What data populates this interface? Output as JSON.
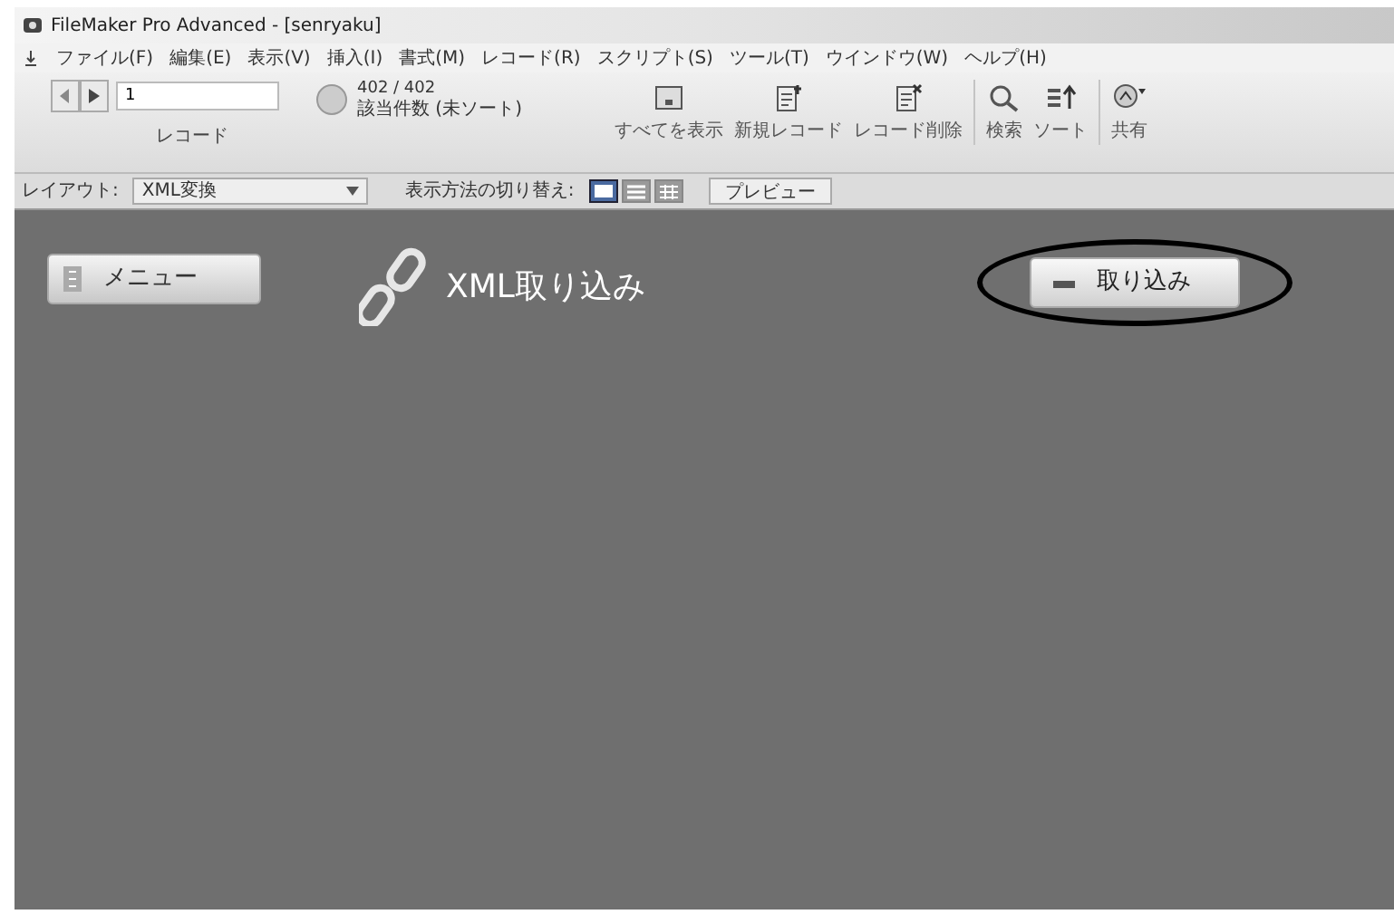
{
  "window": {
    "title": "FileMaker Pro Advanced - [senryaku]"
  },
  "menu": [
    "ファイル(F)",
    "編集(E)",
    "表示(V)",
    "挿入(I)",
    "書式(M)",
    "レコード(R)",
    "スクリプト(S)",
    "ツール(T)",
    "ウインドウ(W)",
    "ヘルプ(H)"
  ],
  "toolbar": {
    "record_field": "1",
    "record_label": "レコード",
    "count": "402 / 402",
    "count_status": "該当件数 (未ソート)",
    "buttons": [
      {
        "kind": "show-all",
        "label": "すべてを表示"
      },
      {
        "kind": "new",
        "label": "新規レコード"
      },
      {
        "kind": "delete",
        "label": "レコード削除"
      },
      {
        "kind": "find",
        "label": "検索"
      },
      {
        "kind": "sort",
        "label": "ソート"
      },
      {
        "kind": "share",
        "label": "共有"
      }
    ]
  },
  "layout_bar": {
    "label": "レイアウト:",
    "layout": "XML変換",
    "view_label": "表示方法の切り替え:",
    "views": [
      {
        "kind": "form",
        "selected": true
      },
      {
        "kind": "list",
        "selected": false
      },
      {
        "kind": "table",
        "selected": false
      }
    ],
    "preview": "プレビュー"
  },
  "content": {
    "menu_button": "メニュー",
    "heading": "XML取り込み",
    "import_button": "取り込み",
    "import_circled": true
  }
}
